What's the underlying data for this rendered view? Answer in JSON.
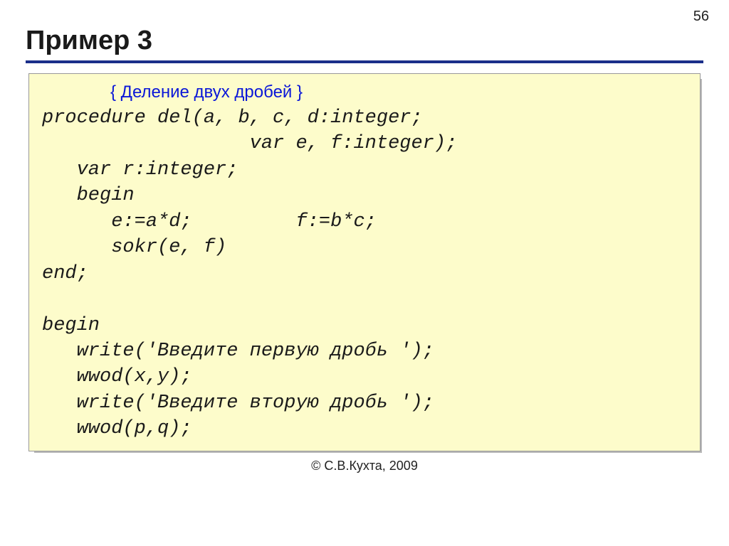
{
  "page_number": "56",
  "title": "Пример 3",
  "code_comment": "{ Деление двух дробей }",
  "code_body": "procedure del(a, b, c, d:integer;\n                  var e, f:integer);\n   var r:integer;\n   begin\n      e:=a*d;         f:=b*c;\n      sokr(e, f)\nend;\n\nbegin\n   write('Введите первую дробь ');\n   wwod(x,y);\n   write('Введите вторую дробь ');\n   wwod(p,q);",
  "footer": "© С.В.Кухта, 2009"
}
